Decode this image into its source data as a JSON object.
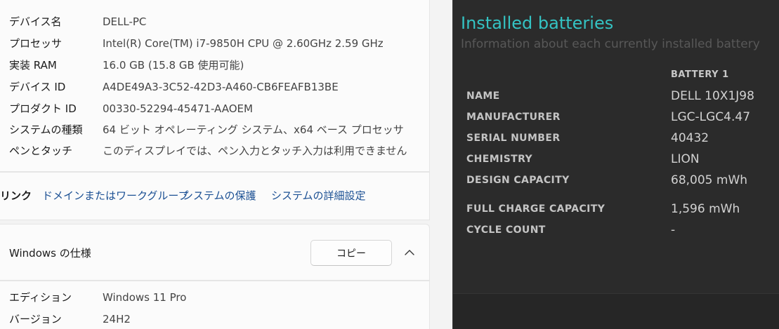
{
  "system_specs": {
    "rows": [
      {
        "label": "デバイス名",
        "value": "DELL-PC"
      },
      {
        "label": "プロセッサ",
        "value": "Intel(R) Core(TM) i7-9850H CPU @ 2.60GHz   2.59 GHz"
      },
      {
        "label": "実装 RAM",
        "value": "16.0 GB (15.8 GB 使用可能)"
      },
      {
        "label": "デバイス ID",
        "value": "A4DE49A3-3C52-42D3-A460-CB6FEAFB13BE"
      },
      {
        "label": "プロダクト ID",
        "value": "00330-52294-45471-AAOEM"
      },
      {
        "label": "システムの種類",
        "value": "64 ビット オペレーティング システム、x64 ベース プロセッサ"
      },
      {
        "label": "ペンとタッチ",
        "value": "このディスプレイでは、ペン入力とタッチ入力は利用できません"
      }
    ]
  },
  "related_links": {
    "title": "リンク",
    "links": [
      "ドメインまたはワークグループ",
      "システムの保護",
      "システムの詳細設定"
    ]
  },
  "windows_spec": {
    "title": "Windows の仕様",
    "copy_label": "コピー",
    "rows": [
      {
        "label": "エディション",
        "value": "Windows 11 Pro"
      },
      {
        "label": "バージョン",
        "value": "24H2"
      }
    ]
  },
  "battery_report": {
    "title": "Installed batteries",
    "subtitle": "Information about each currently installed battery",
    "column_header": "BATTERY 1",
    "rows": [
      {
        "label": "NAME",
        "value": "DELL 10X1J98"
      },
      {
        "label": "MANUFACTURER",
        "value": "LGC-LGC4.47"
      },
      {
        "label": "SERIAL NUMBER",
        "value": "40432"
      },
      {
        "label": "CHEMISTRY",
        "value": "LION"
      },
      {
        "label": "DESIGN CAPACITY",
        "value": "68,005 mWh"
      },
      {
        "label": "FULL CHARGE CAPACITY",
        "value": "1,596 mWh"
      },
      {
        "label": "CYCLE COUNT",
        "value": "-"
      }
    ]
  },
  "colors": {
    "accent_title": "#34c3c3",
    "link": "#1a4f93",
    "dark_bg": "#2b2b2b"
  },
  "icons": {
    "collapse": "chevron-up-icon"
  }
}
